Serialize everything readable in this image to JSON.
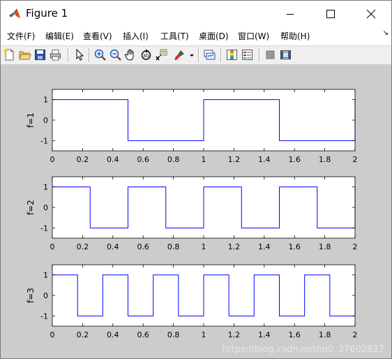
{
  "window": {
    "title": "Figure 1",
    "controls": [
      "minimize",
      "maximize",
      "close"
    ]
  },
  "menu": [
    {
      "label": "文件(F)"
    },
    {
      "label": "编辑(E)"
    },
    {
      "label": "查看(V)"
    },
    {
      "label": "插入(I)"
    },
    {
      "label": "工具(T)"
    },
    {
      "label": "桌面(D)"
    },
    {
      "label": "窗口(W)"
    },
    {
      "label": "帮助(H)"
    }
  ],
  "menu_expand_glyph": "↘",
  "toolbar": [
    "new-figure-icon",
    "open-file-icon",
    "save-icon",
    "print-icon",
    "select-arrow-icon",
    "zoom-in-icon",
    "zoom-out-icon",
    "pan-hand-icon",
    "rotate-3d-icon",
    "data-cursor-icon",
    "brush-icon",
    "brush-dropdown-icon",
    "link-plot-icon",
    "colorbar-icon",
    "legend-icon",
    "hide-plot-tools-icon",
    "show-plot-tools-icon"
  ],
  "colors": {
    "figure_background": "#cccccc",
    "axes_background": "#ffffff",
    "line": "#0000ff",
    "matlab_icon": "#d95319"
  },
  "watermark": "https://blog.csdn.net/m0_37602827",
  "chart_data": [
    {
      "type": "line",
      "ylabel": "f=1",
      "xlim": [
        0,
        2
      ],
      "ylim": [
        -1.5,
        1.5
      ],
      "xticks": [
        "0",
        "0.2",
        "0.4",
        "0.6",
        "0.8",
        "1",
        "1.2",
        "1.4",
        "1.6",
        "1.8",
        "2"
      ],
      "yticks": [
        "1",
        "0",
        "-1"
      ],
      "x": [
        0,
        0.5,
        0.5,
        1,
        1,
        1.5,
        1.5,
        2,
        2
      ],
      "y": [
        1,
        1,
        -1,
        -1,
        1,
        1,
        -1,
        -1,
        1
      ]
    },
    {
      "type": "line",
      "ylabel": "f=2",
      "xlim": [
        0,
        2
      ],
      "ylim": [
        -1.5,
        1.5
      ],
      "xticks": [
        "0",
        "0.2",
        "0.4",
        "0.6",
        "0.8",
        "1",
        "1.2",
        "1.4",
        "1.6",
        "1.8",
        "2"
      ],
      "yticks": [
        "1",
        "0",
        "-1"
      ],
      "x": [
        0,
        0.25,
        0.25,
        0.5,
        0.5,
        0.75,
        0.75,
        1,
        1,
        1.25,
        1.25,
        1.5,
        1.5,
        1.75,
        1.75,
        2,
        2
      ],
      "y": [
        1,
        1,
        -1,
        -1,
        1,
        1,
        -1,
        -1,
        1,
        1,
        -1,
        -1,
        1,
        1,
        -1,
        -1,
        1
      ]
    },
    {
      "type": "line",
      "ylabel": "f=3",
      "xlim": [
        0,
        2
      ],
      "ylim": [
        -1.5,
        1.5
      ],
      "xticks": [
        "0",
        "0.2",
        "0.4",
        "0.6",
        "0.8",
        "1",
        "1.2",
        "1.4",
        "1.6",
        "1.8",
        "2"
      ],
      "yticks": [
        "1",
        "0",
        "-1"
      ],
      "x": [
        0,
        0.1667,
        0.1667,
        0.3333,
        0.3333,
        0.5,
        0.5,
        0.6667,
        0.6667,
        0.8333,
        0.8333,
        1,
        1,
        1.1667,
        1.1667,
        1.3333,
        1.3333,
        1.5,
        1.5,
        1.6667,
        1.6667,
        1.8333,
        1.8333,
        2,
        2
      ],
      "y": [
        1,
        1,
        -1,
        -1,
        1,
        1,
        -1,
        -1,
        1,
        1,
        -1,
        -1,
        1,
        1,
        -1,
        -1,
        1,
        1,
        -1,
        -1,
        1,
        1,
        -1,
        -1,
        1
      ]
    }
  ]
}
